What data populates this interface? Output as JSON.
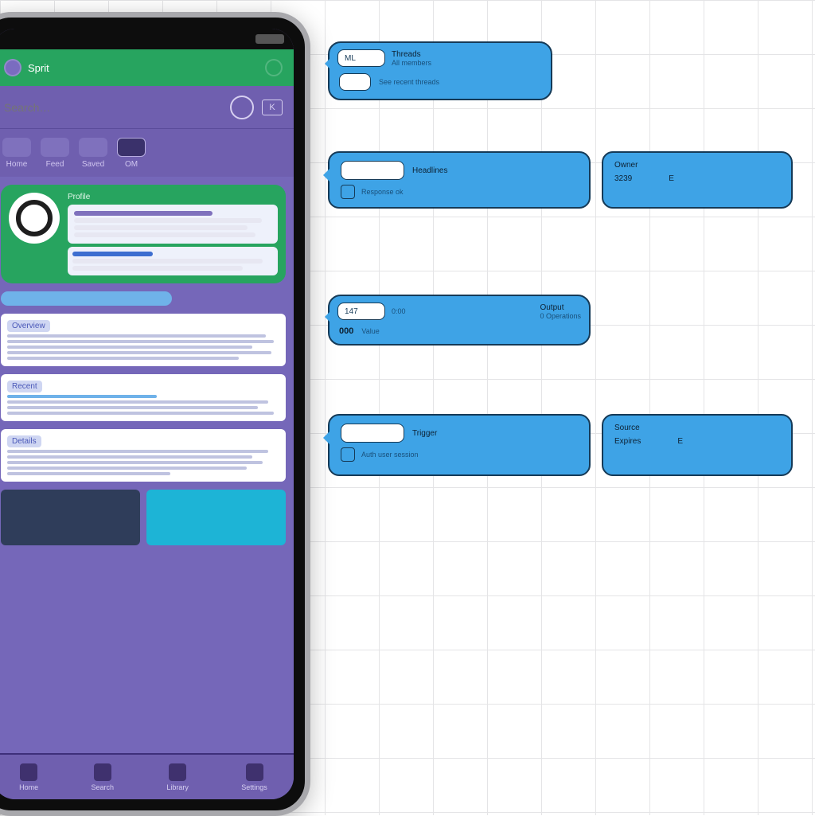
{
  "colors": {
    "brand_purple": "#6f5faf",
    "accent_green": "#27a45f",
    "bubble_blue": "#3ea3e6"
  },
  "phone": {
    "top_bar": {
      "title": "Sprit",
      "icon": "notification-icon"
    },
    "search": {
      "placeholder": "Search…",
      "shortcut": "K"
    },
    "tabs": [
      {
        "label": "Home"
      },
      {
        "label": "Feed"
      },
      {
        "label": "Saved"
      },
      {
        "label": "OM"
      }
    ],
    "profile": {
      "heading": "Profile"
    },
    "sections": [
      {
        "title": "Overview"
      },
      {
        "title": "Recent"
      },
      {
        "title": "Details"
      }
    ],
    "bottom_nav": [
      {
        "label": "Home"
      },
      {
        "label": "Search"
      },
      {
        "label": "Library"
      },
      {
        "label": "Settings"
      }
    ]
  },
  "bubbles": [
    {
      "id": "b1",
      "kind": "small",
      "field": "ML",
      "title": "Threads",
      "lines": [
        "All members",
        "See recent threads"
      ]
    },
    {
      "id": "b2",
      "kind": "wide",
      "seg1": {
        "field": "",
        "title": "Headlines",
        "rows": [
          {
            "k": "Response ok",
            "v": ""
          }
        ],
        "icon": "link-icon"
      },
      "seg2": {
        "rows": [
          {
            "k": "Owner",
            "v": ""
          },
          {
            "k": "3239",
            "v": "E"
          }
        ]
      }
    },
    {
      "id": "b3",
      "kind": "small",
      "field": "147",
      "extra": "0:00",
      "title": "Output",
      "lines": [
        "0  Operations",
        "Value"
      ]
    },
    {
      "id": "b4",
      "kind": "wide",
      "seg1": {
        "field": "",
        "title": "Trigger",
        "rows": [
          {
            "k": "Auth user session",
            "v": ""
          }
        ],
        "icon": "bolt-icon"
      },
      "seg2": {
        "rows": [
          {
            "k": "Source",
            "v": ""
          },
          {
            "k": "Expires",
            "v": "E"
          }
        ]
      }
    }
  ]
}
